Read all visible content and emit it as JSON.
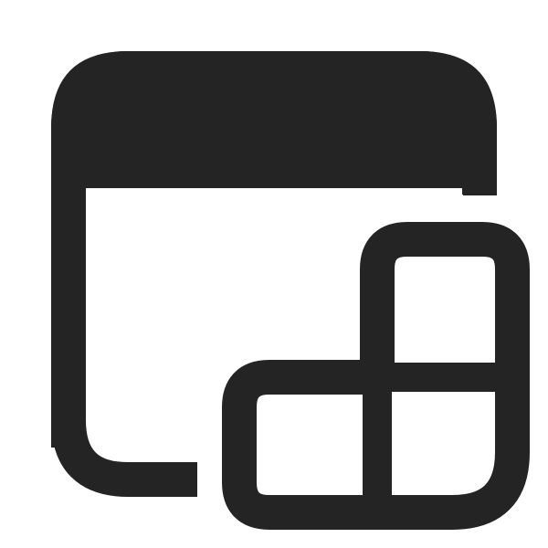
{
  "icon": {
    "name": "app-window-grid-icon",
    "color": "#242424",
    "background": "#ffffff"
  }
}
